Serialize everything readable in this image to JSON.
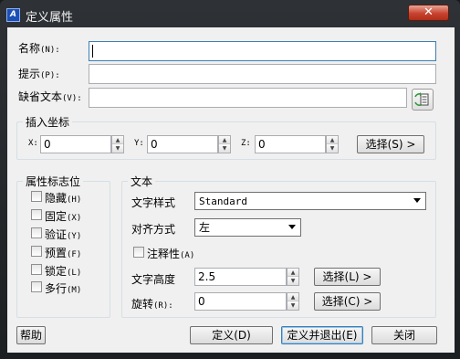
{
  "window": {
    "title": "定义属性",
    "close_label": "✕"
  },
  "fields": {
    "tag_label": "名称",
    "tag_key": "(N):",
    "tag_value": "",
    "prompt_label": "提示",
    "prompt_key": "(P):",
    "prompt_value": "",
    "default_label": "缺省文本",
    "default_key": "(V):",
    "default_value": ""
  },
  "insertion": {
    "title": "插入坐标",
    "x_label": "X:",
    "x_value": "0",
    "y_label": "Y:",
    "y_value": "0",
    "z_label": "Z:",
    "z_value": "0",
    "pick_label": "选择(S) >"
  },
  "flags": {
    "title": "属性标志位",
    "items": [
      {
        "label": "隐藏",
        "key": "(H)",
        "checked": false
      },
      {
        "label": "固定",
        "key": "(X)",
        "checked": false
      },
      {
        "label": "验证",
        "key": "(Y)",
        "checked": false
      },
      {
        "label": "预置",
        "key": "(F)",
        "checked": false
      },
      {
        "label": "锁定",
        "key": "(L)",
        "checked": false
      },
      {
        "label": "多行",
        "key": "(M)",
        "checked": false
      }
    ]
  },
  "text": {
    "title": "文本",
    "style_label": "文字样式",
    "style_value": "Standard",
    "justify_label": "对齐方式",
    "justify_value": "左",
    "annotative_label": "注释性",
    "annotative_key": "(A)",
    "height_label": "文字高度",
    "height_value": "2.5",
    "height_pick": "选择(L) >",
    "rotation_label": "旋转",
    "rotation_key": "(R):",
    "rotation_value": "0",
    "rotation_pick": "选择(C) >"
  },
  "footer": {
    "help": "帮助",
    "define": "定义(D)",
    "define_exit": "定义并退出(E)",
    "close": "关闭"
  }
}
